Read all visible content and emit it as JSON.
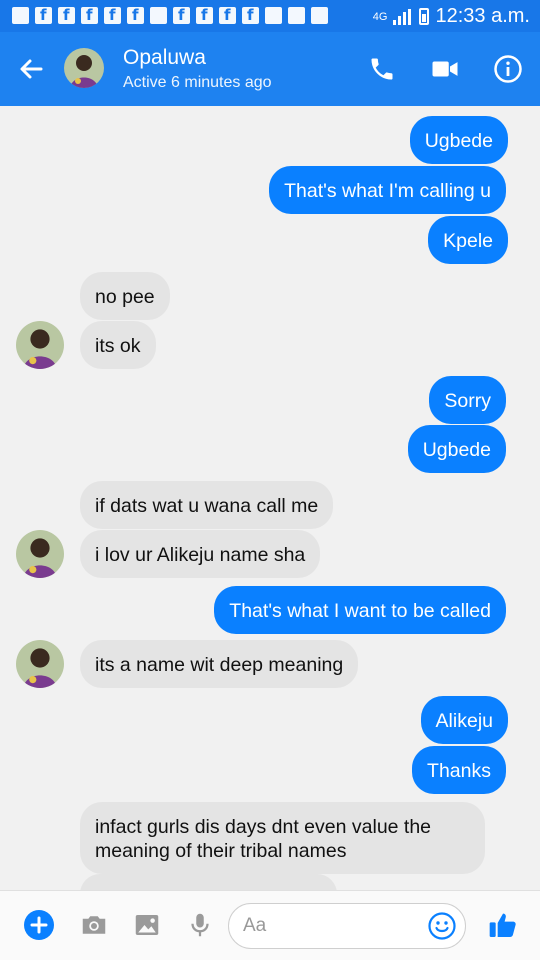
{
  "status_bar": {
    "network": "4G",
    "time": "12:33 a.m."
  },
  "header": {
    "contact_name": "Opaluwa",
    "activity": "Active 6 minutes ago"
  },
  "messages": [
    {
      "side": "out",
      "text": "Ugbede"
    },
    {
      "side": "out",
      "text": "That's what I'm calling u"
    },
    {
      "side": "out",
      "text": "Kpele"
    },
    {
      "side": "in",
      "text": "no pee"
    },
    {
      "side": "in",
      "text": "its ok"
    },
    {
      "side": "out",
      "text": "Sorry"
    },
    {
      "side": "out",
      "text": "Ugbede"
    },
    {
      "side": "in",
      "text": "if dats wat u wana call me"
    },
    {
      "side": "in",
      "text": "i lov ur Alikeju name sha"
    },
    {
      "side": "out",
      "text": "That's what I want to be called"
    },
    {
      "side": "in",
      "text": "its a name wit deep meaning"
    },
    {
      "side": "out",
      "text": "Alikeju"
    },
    {
      "side": "out",
      "text": "Thanks"
    },
    {
      "side": "in",
      "text": "infact gurls dis days dnt even value the meaning of their tribal names"
    }
  ],
  "composer": {
    "placeholder": "Aa"
  },
  "icons": {
    "back": "arrow-left-icon",
    "call": "phone-icon",
    "video": "video-camera-icon",
    "info": "info-icon",
    "more": "plus-icon",
    "camera": "camera-icon",
    "gallery": "image-icon",
    "mic": "microphone-icon",
    "emoji": "smiley-icon",
    "like": "thumbs-up-icon"
  },
  "colors": {
    "brand": "#1e82f0",
    "outgoing_bubble": "#0a80ff",
    "incoming_bubble": "#e4e4e4",
    "background": "#f1f1f1"
  }
}
